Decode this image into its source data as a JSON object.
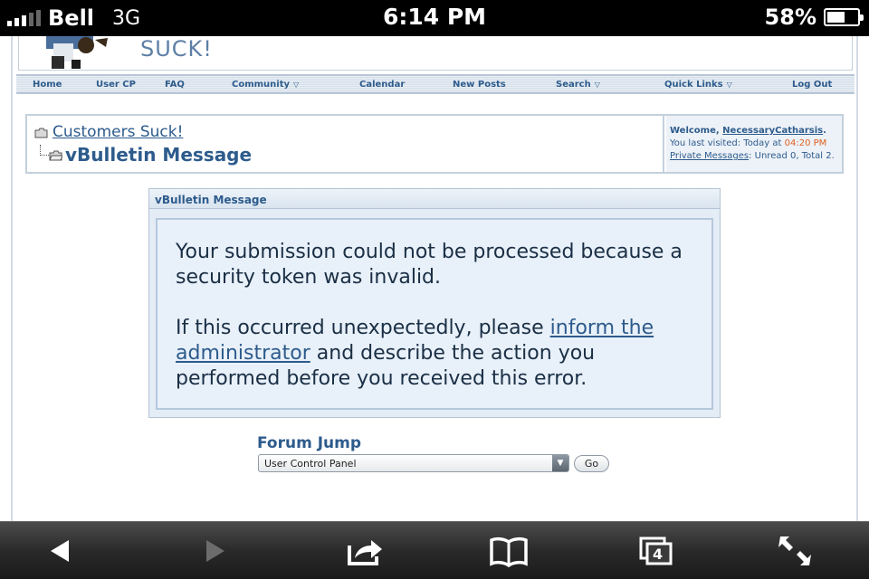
{
  "status_bar": {
    "carrier": "Bell",
    "network": "3G",
    "time": "6:14 PM",
    "battery_percent_label": "58%",
    "battery_level": 0.58,
    "signal_bars": 3
  },
  "site": {
    "logo_text": "SUCK!"
  },
  "navbar": {
    "items": [
      {
        "label": "Home",
        "dropdown": false
      },
      {
        "label": "User CP",
        "dropdown": false
      },
      {
        "label": "FAQ",
        "dropdown": false
      },
      {
        "label": "Community",
        "dropdown": true
      },
      {
        "label": "Calendar",
        "dropdown": false
      },
      {
        "label": "New Posts",
        "dropdown": false
      },
      {
        "label": "Search",
        "dropdown": true
      },
      {
        "label": "Quick Links",
        "dropdown": true
      },
      {
        "label": "Log Out",
        "dropdown": false
      }
    ]
  },
  "breadcrumb": {
    "forum_link": "Customers Suck!",
    "page_title": "vBulletin Message"
  },
  "welcome": {
    "prefix": "Welcome, ",
    "username": "NecessaryCatharsis",
    "suffix": ".",
    "last_visited_label": "You last visited: Today at ",
    "last_visited_time": "04:20 PM",
    "pm_link": "Private Messages",
    "pm_counts": ": Unread 0, Total 2."
  },
  "message": {
    "header": "vBulletin Message",
    "paragraph1": "Your submission could not be processed because a security token was invalid.",
    "paragraph2_before": "If this occurred unexpectedly, please ",
    "paragraph2_link": "inform the administrator",
    "paragraph2_after": " and describe the action you performed before you received this error."
  },
  "forum_jump": {
    "label": "Forum Jump",
    "selected": "User Control Panel",
    "go_label": "Go"
  },
  "toolbar": {
    "tabs_count": "4",
    "buttons": [
      "back-icon",
      "forward-icon",
      "share-icon",
      "bookmarks-icon",
      "tabs-icon",
      "fullscreen-icon"
    ]
  },
  "colors": {
    "link": "#2d5b8c",
    "visited_time": "#e06020",
    "message_bg": "#e8f0f9"
  }
}
